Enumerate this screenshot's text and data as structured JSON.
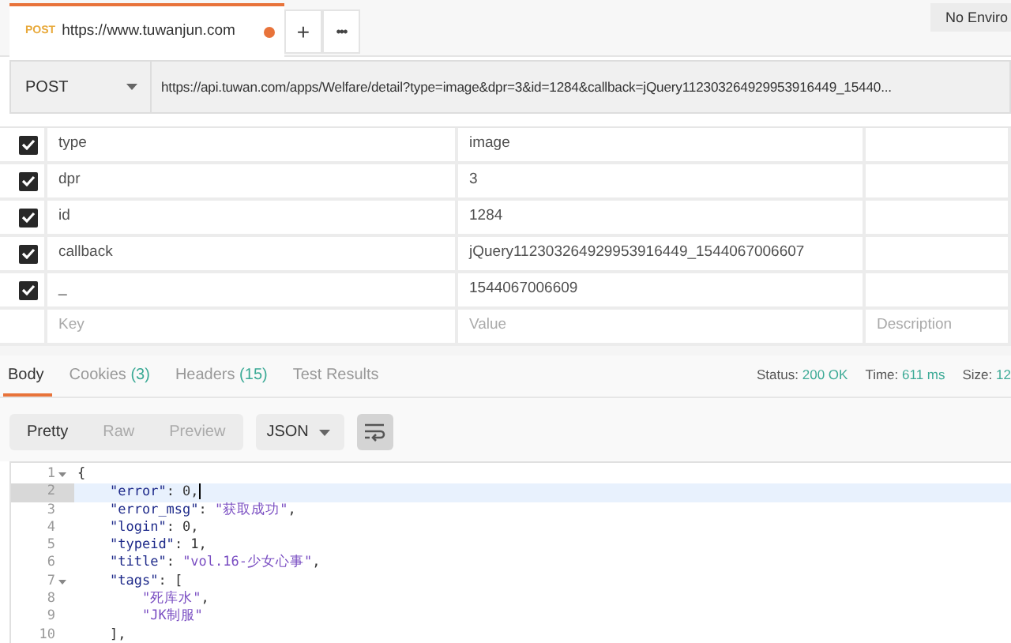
{
  "request_tab": {
    "method": "POST",
    "title": "https://www.tuwanjun.com",
    "unsaved": true
  },
  "tab_actions": [
    "+",
    "•••"
  ],
  "environment": {
    "label": "No Enviro"
  },
  "request": {
    "method": "POST",
    "url": "https://api.tuwan.com/apps/Welfare/detail?type=image&dpr=3&id=1284&callback=jQuery112303264929953916449_15440..."
  },
  "params": [
    {
      "checked": true,
      "key": "type",
      "value": "image"
    },
    {
      "checked": true,
      "key": "dpr",
      "value": "3"
    },
    {
      "checked": true,
      "key": "id",
      "value": "1284"
    },
    {
      "checked": true,
      "key": "callback",
      "value": "jQuery112303264929953916449_1544067006607"
    },
    {
      "checked": true,
      "key": "_",
      "value": "1544067006609"
    }
  ],
  "params_placeholders": {
    "key": "Key",
    "value": "Value",
    "description": "Description"
  },
  "response_tabs": [
    {
      "label": "Body",
      "selected": true
    },
    {
      "label": "Cookies",
      "count": "(3)",
      "selected": false
    },
    {
      "label": "Headers",
      "count": "(15)",
      "selected": false
    },
    {
      "label": "Test Results",
      "selected": false
    }
  ],
  "status": [
    {
      "label": "Status:",
      "value": "200 OK"
    },
    {
      "label": "Time:",
      "value": "611 ms"
    },
    {
      "label": "Size:",
      "value": "12"
    }
  ],
  "view_modes": [
    {
      "label": "Pretty",
      "selected": true
    },
    {
      "label": "Raw",
      "selected": false
    },
    {
      "label": "Preview",
      "selected": false
    }
  ],
  "format": {
    "label": "JSON"
  },
  "wrap_active": true,
  "code": [
    {
      "number": "1",
      "text": "{",
      "foldable": true,
      "selected": false
    },
    {
      "number": "2",
      "text": "    \"error\": 0,",
      "foldable": false,
      "selected": true
    },
    {
      "number": "3",
      "text": "    \"error_msg\": \"获取成功\",",
      "foldable": false,
      "selected": false
    },
    {
      "number": "4",
      "text": "    \"login\": 0,",
      "foldable": false,
      "selected": false
    },
    {
      "number": "5",
      "text": "    \"typeid\": 1,",
      "foldable": false,
      "selected": false
    },
    {
      "number": "6",
      "text": "    \"title\": \"vol.16-少女心事\",",
      "foldable": false,
      "selected": false
    },
    {
      "number": "7",
      "text": "    \"tags\": [",
      "foldable": true,
      "selected": false
    },
    {
      "number": "8",
      "text": "        \"死库水\",",
      "foldable": false,
      "selected": false
    },
    {
      "number": "9",
      "text": "        \"JK制服\"",
      "foldable": false,
      "selected": false
    },
    {
      "number": "10",
      "text": "    ],",
      "foldable": false,
      "selected": false
    }
  ]
}
